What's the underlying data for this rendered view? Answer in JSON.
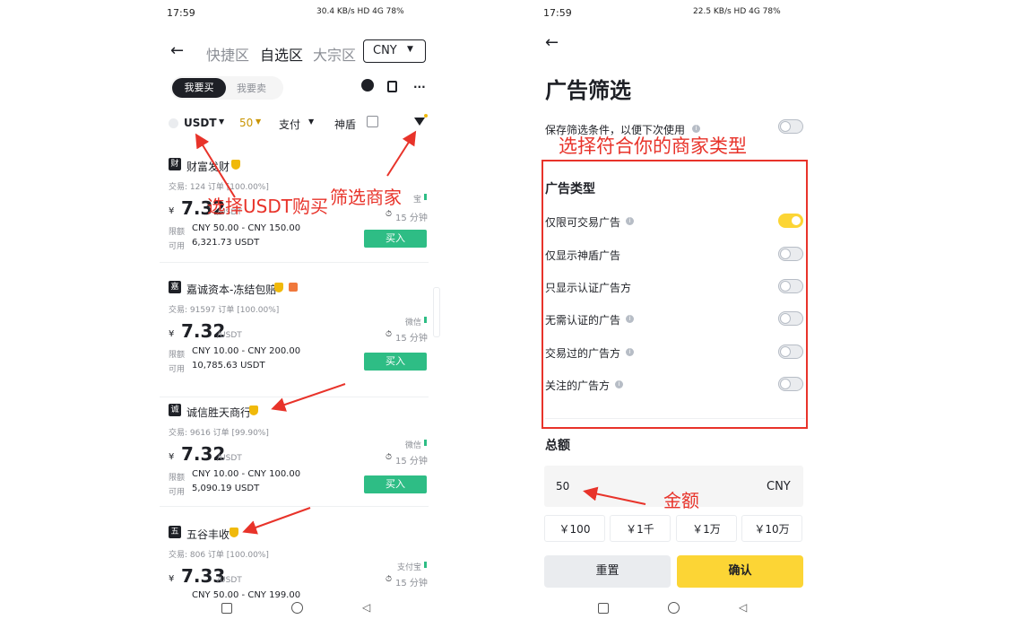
{
  "left": {
    "status_time": "17:59",
    "status_right": "30.4 KB/s  HD  4G  78%",
    "tabs": [
      "快捷区",
      "自选区",
      "大宗区"
    ],
    "currency": "CNY",
    "side_buy": "我要买",
    "side_sell": "我要卖",
    "filter": {
      "asset": "USDT",
      "amount": "50",
      "payment": "支付",
      "shield": "神盾"
    },
    "ads": [
      {
        "name": "财富发财",
        "logo": "财",
        "stats": "交易: 124 订单 [100.00%]",
        "price": "7.32",
        "unit": "/USDT",
        "limit_label": "限额",
        "limit": "CNY 50.00 - CNY 150.00",
        "avail_label": "可用",
        "avail": "6,321.73 USDT",
        "payment": "宝",
        "time": "15 分钟",
        "buy": "买入"
      },
      {
        "name": "嘉诚资本-冻结包赔",
        "logo": "嘉",
        "stats": "交易: 91597 订单 [100.00%]",
        "price": "7.32",
        "unit": "/USDT",
        "limit_label": "限额",
        "limit": "CNY 10.00 - CNY 200.00",
        "avail_label": "可用",
        "avail": "10,785.63 USDT",
        "payment": "微信",
        "time": "15 分钟",
        "buy": "买入"
      },
      {
        "name": "诚信胜天商行",
        "logo": "诚",
        "stats": "交易: 9616 订单 [99.90%]",
        "price": "7.32",
        "unit": "/USDT",
        "limit_label": "限额",
        "limit": "CNY 10.00 - CNY 100.00",
        "avail_label": "可用",
        "avail": "5,090.19 USDT",
        "payment": "微信",
        "time": "15 分钟",
        "buy": "买入"
      },
      {
        "name": "五谷丰收",
        "logo": "五",
        "stats": "交易: 806 订单 [100.00%]",
        "price": "7.33",
        "unit": "/USDT",
        "limit_label": "",
        "limit": "CNY 50.00 - CNY 199.00",
        "avail_label": "",
        "avail": "",
        "payment": "支付宝",
        "time": "15 分钟",
        "buy": ""
      }
    ]
  },
  "right": {
    "status_time": "17:59",
    "status_right": "22.5 KB/s  HD  4G  78%",
    "title": "广告筛选",
    "save_label": "保存筛选条件，以便下次使用",
    "section_title": "广告类型",
    "options": [
      {
        "label": "仅限可交易广告",
        "on": true,
        "info": true
      },
      {
        "label": "仅显示神盾广告",
        "on": false,
        "info": false
      },
      {
        "label": "只显示认证广告方",
        "on": false,
        "info": false
      },
      {
        "label": "无需认证的广告",
        "on": false,
        "info": true
      },
      {
        "label": "交易过的广告方",
        "on": false,
        "info": true
      },
      {
        "label": "关注的广告方",
        "on": false,
        "info": true
      }
    ],
    "amount_title": "总额",
    "amount_value": "50",
    "amount_currency": "CNY",
    "quick_amounts": [
      "￥100",
      "￥1千",
      "￥1万",
      "￥10万"
    ],
    "reset": "重置",
    "confirm": "确认"
  },
  "annotations": {
    "select_usdt": "选择USDT购买",
    "filter_merchant": "筛选商家",
    "choose_type": "选择符合你的商家类型",
    "amount": "金额"
  },
  "colors": {
    "accent": "#fcd535",
    "buy_green": "#2ebd85",
    "annotation_red": "#e8332a"
  }
}
